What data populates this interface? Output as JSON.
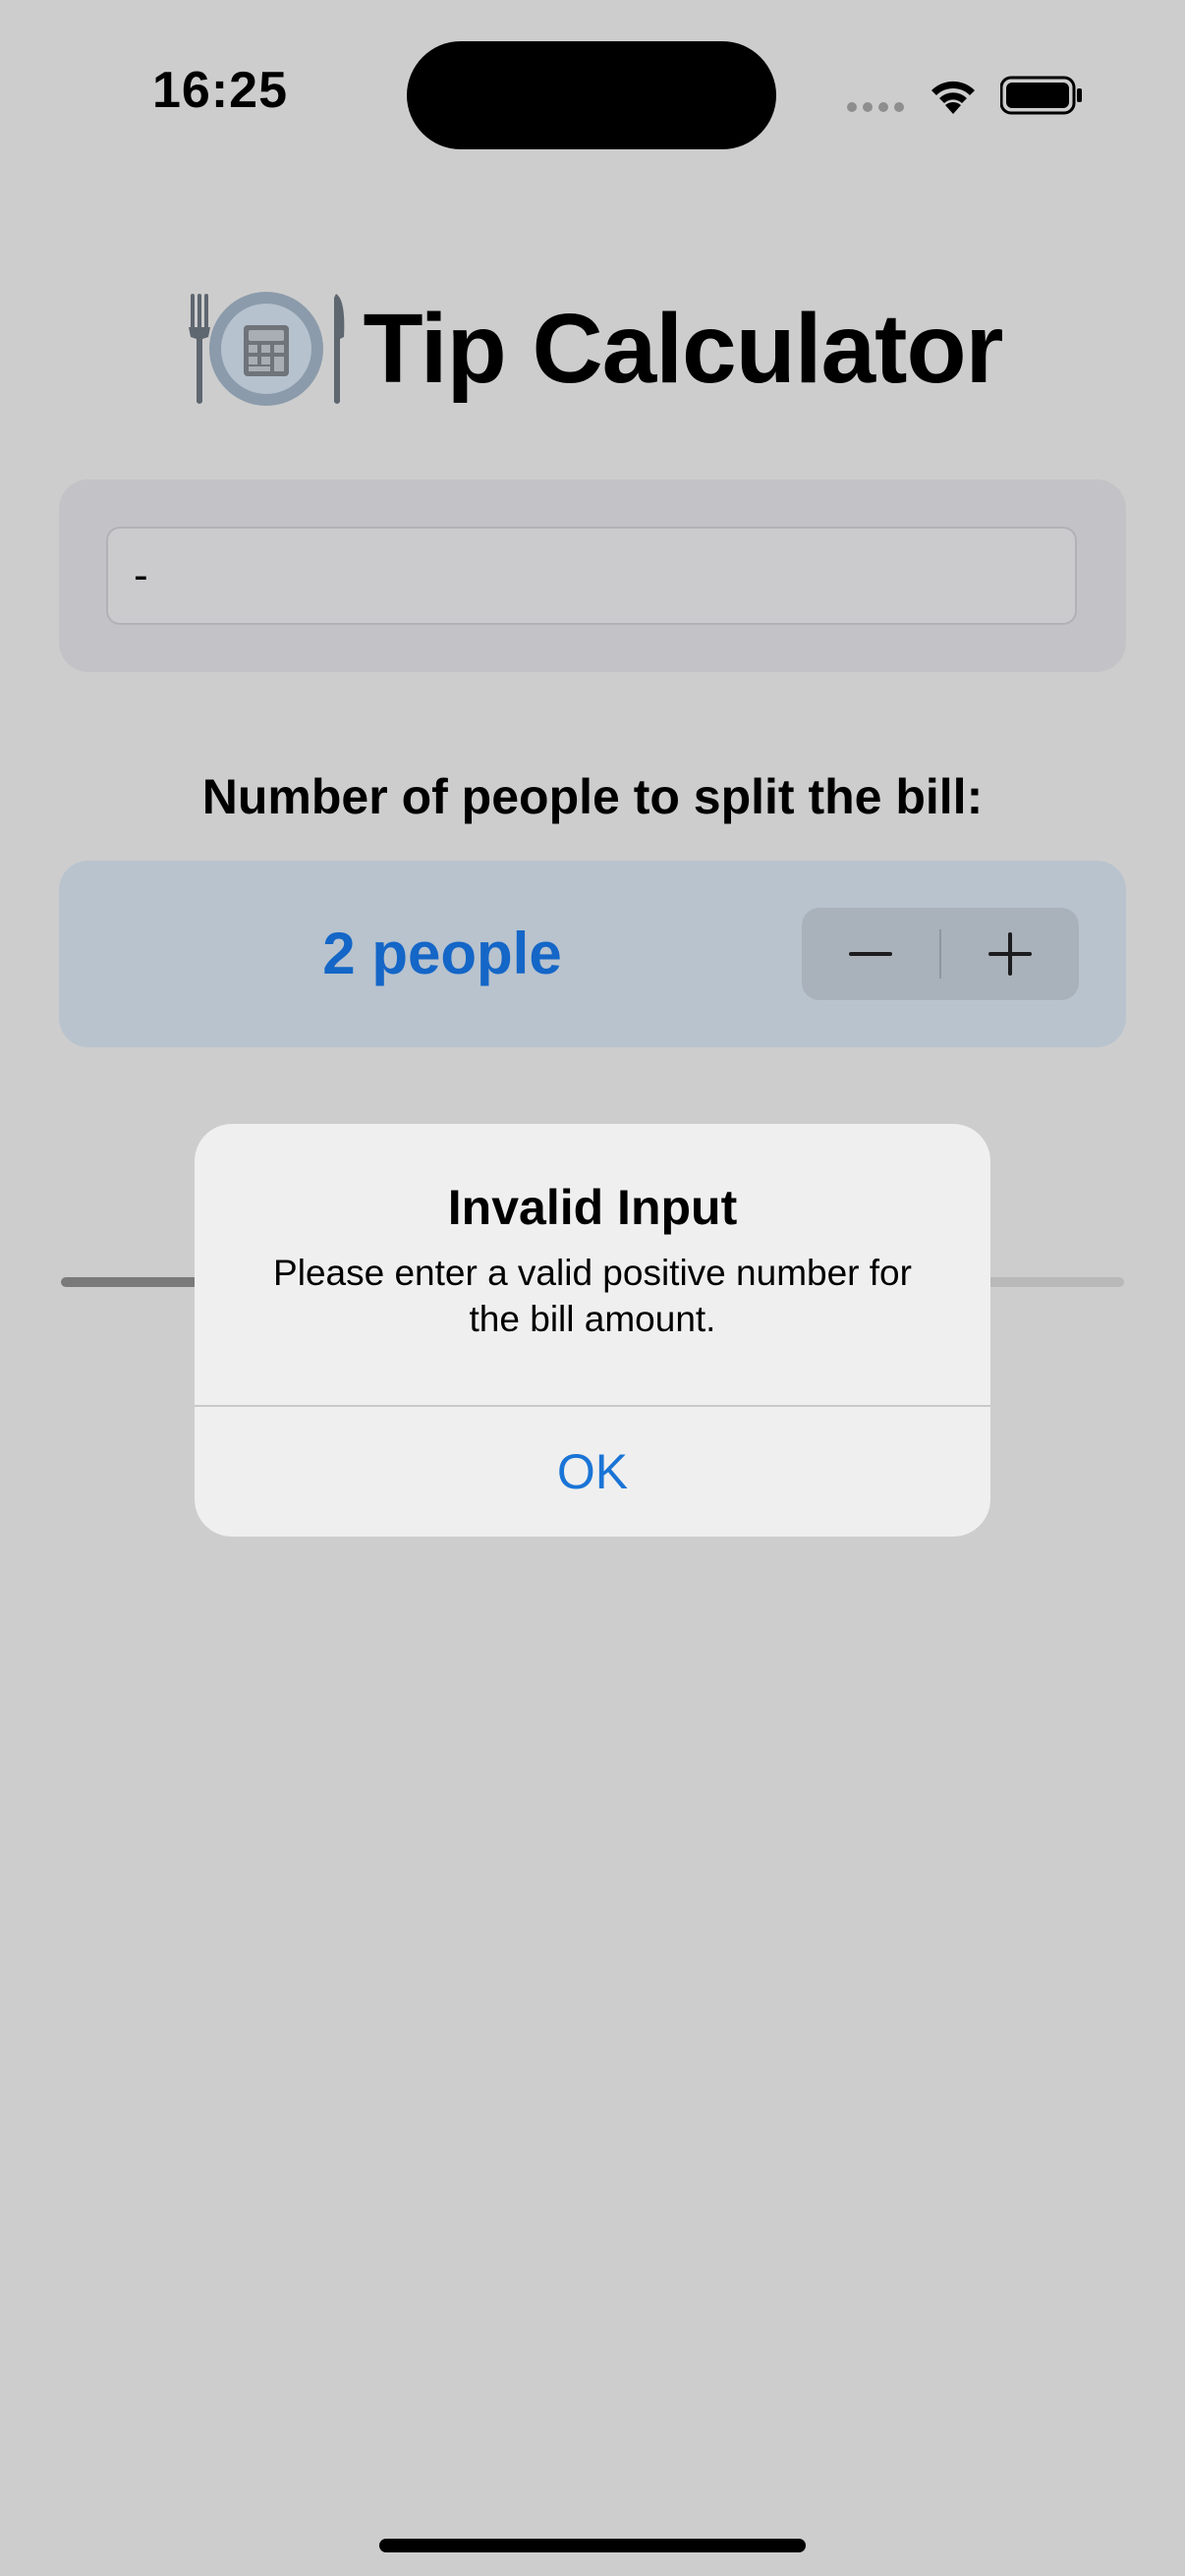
{
  "status_bar": {
    "time": "16:25",
    "icons": [
      "cellular-dots-icon",
      "wifi-icon",
      "battery-icon"
    ]
  },
  "header": {
    "emoji": "🍽️",
    "title": "Tip Calculator"
  },
  "bill": {
    "value": "-"
  },
  "split": {
    "heading": "Number of people to split the bill:",
    "value": "2 people",
    "decrement_icon": "minus-icon",
    "increment_icon": "plus-icon"
  },
  "alert": {
    "title": "Invalid Input",
    "message": "Please enter a valid positive number for the bill amount.",
    "ok_label": "OK"
  },
  "colors": {
    "accent": "#1a74d6",
    "people_text": "#1466c7",
    "background": "#cdcdcd"
  }
}
